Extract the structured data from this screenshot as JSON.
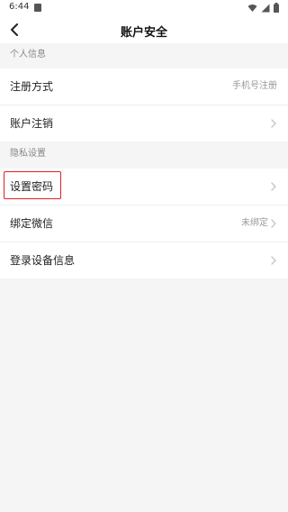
{
  "status_bar": {
    "time": "6:44"
  },
  "header": {
    "title": "账户安全"
  },
  "sections": {
    "personal": {
      "title": "个人信息",
      "register_method": {
        "label": "注册方式",
        "value": "手机号注册"
      },
      "cancel_account": {
        "label": "账户注销"
      }
    },
    "privacy": {
      "title": "隐私设置",
      "set_password": {
        "label": "设置密码"
      },
      "bind_wechat": {
        "label": "绑定微信",
        "value": "未绑定"
      },
      "login_devices": {
        "label": "登录设备信息"
      }
    }
  },
  "colors": {
    "highlight": "#e02020",
    "background": "#f5f5f5"
  }
}
